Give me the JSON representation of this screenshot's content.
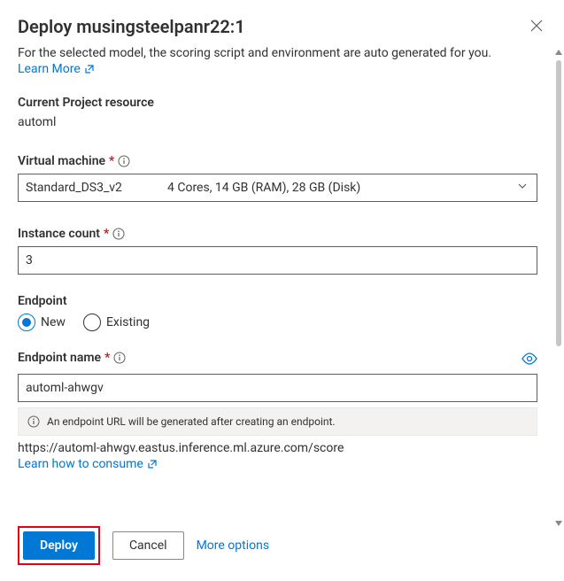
{
  "header": {
    "title": "Deploy musingsteelpanr22:1"
  },
  "intro": {
    "description": "For the selected model, the scoring script and environment are auto generated for you.",
    "learn_more": "Learn More"
  },
  "project": {
    "label": "Current Project resource",
    "value": "automl"
  },
  "vm": {
    "label": "Virtual machine",
    "selected_name": "Standard_DS3_v2",
    "selected_spec": "4 Cores, 14 GB (RAM), 28 GB (Disk)"
  },
  "instance": {
    "label": "Instance count",
    "value": "3"
  },
  "endpoint": {
    "heading": "Endpoint",
    "option_new": "New",
    "option_existing": "Existing",
    "name_label": "Endpoint name",
    "name_value": "automl-ahwgv",
    "info_text": "An endpoint URL will be generated after creating an endpoint.",
    "url": "https://automl-ahwgv.eastus.inference.ml.azure.com/score",
    "consume_link": "Learn how to consume"
  },
  "footer": {
    "deploy": "Deploy",
    "cancel": "Cancel",
    "more": "More options"
  }
}
